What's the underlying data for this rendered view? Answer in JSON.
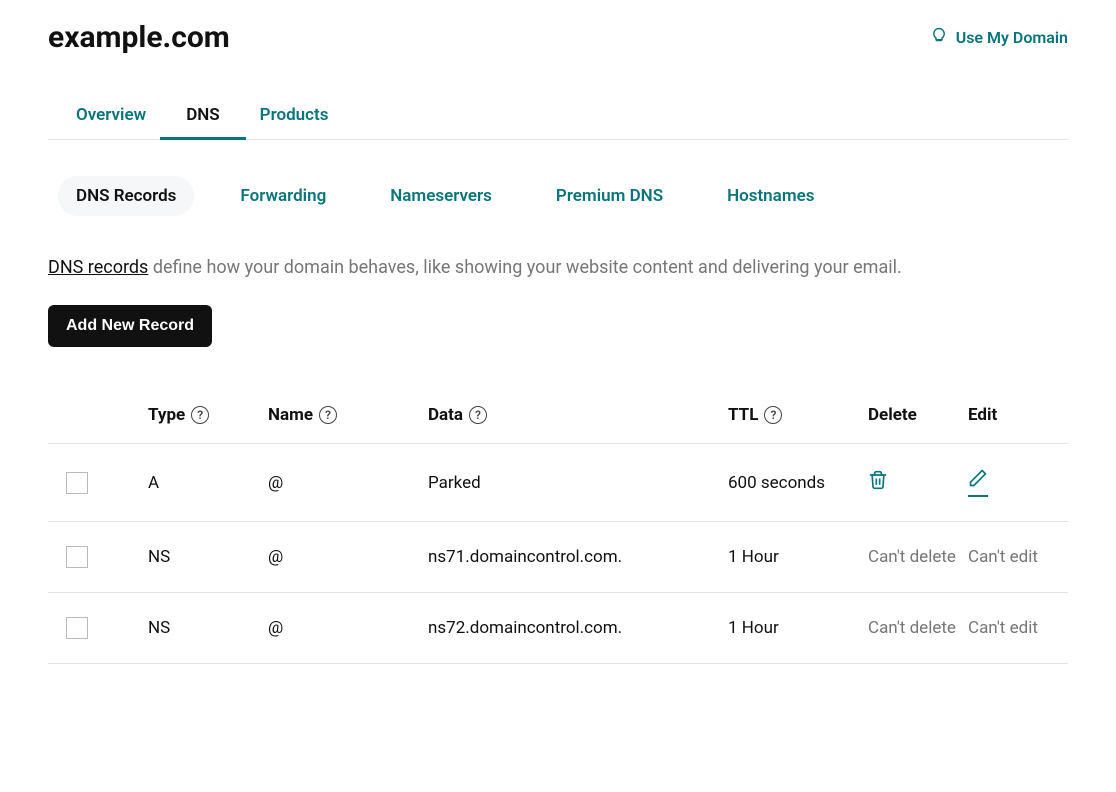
{
  "header": {
    "domain": "example.com",
    "useMyDomain": "Use My Domain"
  },
  "tabsPrimary": [
    {
      "label": "Overview",
      "active": false
    },
    {
      "label": "DNS",
      "active": true
    },
    {
      "label": "Products",
      "active": false
    }
  ],
  "tabsSecondary": [
    {
      "label": "DNS Records",
      "active": true
    },
    {
      "label": "Forwarding",
      "active": false
    },
    {
      "label": "Nameservers",
      "active": false
    },
    {
      "label": "Premium DNS",
      "active": false
    },
    {
      "label": "Hostnames",
      "active": false
    }
  ],
  "description": {
    "linkText": "DNS records",
    "rest": " define how your domain behaves, like showing your website content and delivering your email."
  },
  "addButton": "Add New Record",
  "columns": {
    "type": "Type",
    "name": "Name",
    "data": "Data",
    "ttl": "TTL",
    "delete": "Delete",
    "edit": "Edit"
  },
  "records": [
    {
      "type": "A",
      "name": "@",
      "data": "Parked",
      "ttl": "600 seconds",
      "canDelete": true,
      "canEdit": true,
      "deleteText": "",
      "editText": ""
    },
    {
      "type": "NS",
      "name": "@",
      "data": "ns71.domaincontrol.com.",
      "ttl": "1 Hour",
      "canDelete": false,
      "canEdit": false,
      "deleteText": "Can't delete",
      "editText": "Can't edit"
    },
    {
      "type": "NS",
      "name": "@",
      "data": "ns72.domaincontrol.com.",
      "ttl": "1 Hour",
      "canDelete": false,
      "canEdit": false,
      "deleteText": "Can't delete",
      "editText": "Can't edit"
    }
  ]
}
